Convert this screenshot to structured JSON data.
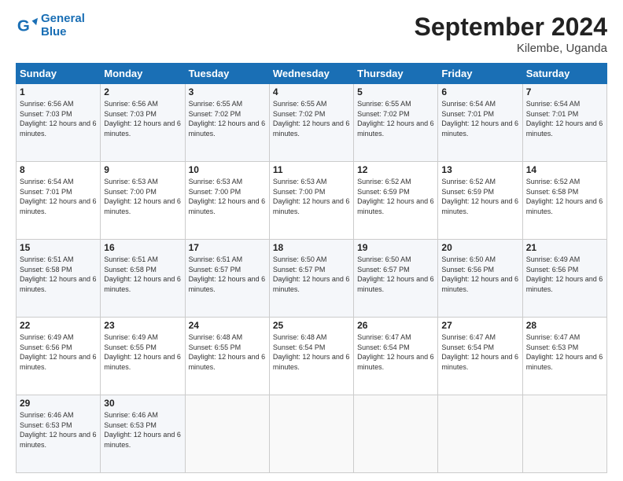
{
  "header": {
    "logo_line1": "General",
    "logo_line2": "Blue",
    "month": "September 2024",
    "location": "Kilembe, Uganda"
  },
  "days_of_week": [
    "Sunday",
    "Monday",
    "Tuesday",
    "Wednesday",
    "Thursday",
    "Friday",
    "Saturday"
  ],
  "weeks": [
    [
      {
        "day": "1",
        "sunrise": "6:56 AM",
        "sunset": "7:03 PM",
        "daylight": "12 hours and 6 minutes."
      },
      {
        "day": "2",
        "sunrise": "6:56 AM",
        "sunset": "7:03 PM",
        "daylight": "12 hours and 6 minutes."
      },
      {
        "day": "3",
        "sunrise": "6:55 AM",
        "sunset": "7:02 PM",
        "daylight": "12 hours and 6 minutes."
      },
      {
        "day": "4",
        "sunrise": "6:55 AM",
        "sunset": "7:02 PM",
        "daylight": "12 hours and 6 minutes."
      },
      {
        "day": "5",
        "sunrise": "6:55 AM",
        "sunset": "7:02 PM",
        "daylight": "12 hours and 6 minutes."
      },
      {
        "day": "6",
        "sunrise": "6:54 AM",
        "sunset": "7:01 PM",
        "daylight": "12 hours and 6 minutes."
      },
      {
        "day": "7",
        "sunrise": "6:54 AM",
        "sunset": "7:01 PM",
        "daylight": "12 hours and 6 minutes."
      }
    ],
    [
      {
        "day": "8",
        "sunrise": "6:54 AM",
        "sunset": "7:01 PM",
        "daylight": "12 hours and 6 minutes."
      },
      {
        "day": "9",
        "sunrise": "6:53 AM",
        "sunset": "7:00 PM",
        "daylight": "12 hours and 6 minutes."
      },
      {
        "day": "10",
        "sunrise": "6:53 AM",
        "sunset": "7:00 PM",
        "daylight": "12 hours and 6 minutes."
      },
      {
        "day": "11",
        "sunrise": "6:53 AM",
        "sunset": "7:00 PM",
        "daylight": "12 hours and 6 minutes."
      },
      {
        "day": "12",
        "sunrise": "6:52 AM",
        "sunset": "6:59 PM",
        "daylight": "12 hours and 6 minutes."
      },
      {
        "day": "13",
        "sunrise": "6:52 AM",
        "sunset": "6:59 PM",
        "daylight": "12 hours and 6 minutes."
      },
      {
        "day": "14",
        "sunrise": "6:52 AM",
        "sunset": "6:58 PM",
        "daylight": "12 hours and 6 minutes."
      }
    ],
    [
      {
        "day": "15",
        "sunrise": "6:51 AM",
        "sunset": "6:58 PM",
        "daylight": "12 hours and 6 minutes."
      },
      {
        "day": "16",
        "sunrise": "6:51 AM",
        "sunset": "6:58 PM",
        "daylight": "12 hours and 6 minutes."
      },
      {
        "day": "17",
        "sunrise": "6:51 AM",
        "sunset": "6:57 PM",
        "daylight": "12 hours and 6 minutes."
      },
      {
        "day": "18",
        "sunrise": "6:50 AM",
        "sunset": "6:57 PM",
        "daylight": "12 hours and 6 minutes."
      },
      {
        "day": "19",
        "sunrise": "6:50 AM",
        "sunset": "6:57 PM",
        "daylight": "12 hours and 6 minutes."
      },
      {
        "day": "20",
        "sunrise": "6:50 AM",
        "sunset": "6:56 PM",
        "daylight": "12 hours and 6 minutes."
      },
      {
        "day": "21",
        "sunrise": "6:49 AM",
        "sunset": "6:56 PM",
        "daylight": "12 hours and 6 minutes."
      }
    ],
    [
      {
        "day": "22",
        "sunrise": "6:49 AM",
        "sunset": "6:56 PM",
        "daylight": "12 hours and 6 minutes."
      },
      {
        "day": "23",
        "sunrise": "6:49 AM",
        "sunset": "6:55 PM",
        "daylight": "12 hours and 6 minutes."
      },
      {
        "day": "24",
        "sunrise": "6:48 AM",
        "sunset": "6:55 PM",
        "daylight": "12 hours and 6 minutes."
      },
      {
        "day": "25",
        "sunrise": "6:48 AM",
        "sunset": "6:54 PM",
        "daylight": "12 hours and 6 minutes."
      },
      {
        "day": "26",
        "sunrise": "6:47 AM",
        "sunset": "6:54 PM",
        "daylight": "12 hours and 6 minutes."
      },
      {
        "day": "27",
        "sunrise": "6:47 AM",
        "sunset": "6:54 PM",
        "daylight": "12 hours and 6 minutes."
      },
      {
        "day": "28",
        "sunrise": "6:47 AM",
        "sunset": "6:53 PM",
        "daylight": "12 hours and 6 minutes."
      }
    ],
    [
      {
        "day": "29",
        "sunrise": "6:46 AM",
        "sunset": "6:53 PM",
        "daylight": "12 hours and 6 minutes."
      },
      {
        "day": "30",
        "sunrise": "6:46 AM",
        "sunset": "6:53 PM",
        "daylight": "12 hours and 6 minutes."
      },
      null,
      null,
      null,
      null,
      null
    ]
  ]
}
